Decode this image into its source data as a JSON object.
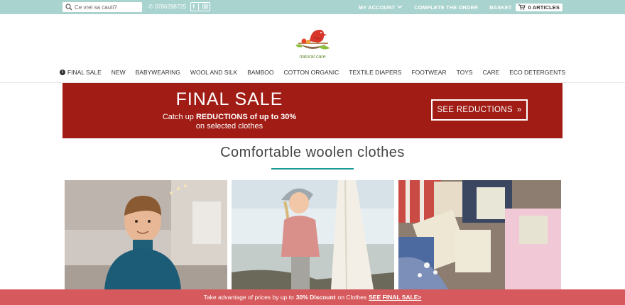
{
  "topbar": {
    "search_placeholder": "Ce vrei sa cauti?",
    "phone": "0786288725",
    "my_account": "MY ACCOUNT",
    "complete_order": "COMPLETE THE ORDER",
    "basket": "BASKET",
    "basket_count": "0 ARTICLES"
  },
  "logo": {
    "text": "natural care"
  },
  "nav": {
    "items": [
      "FINAL SALE",
      "NEW",
      "BABYWEARING",
      "WOOL AND SILK",
      "BAMBOO",
      "COTTON ORGANIC",
      "TEXTILE DIAPERS",
      "FOOTWEAR",
      "TOYS",
      "CARE",
      "ECO DETERGENTS"
    ]
  },
  "banner": {
    "title": "FINAL SALE",
    "sub_prefix": "Catch up ",
    "sub_bold": "REDUCTIONS of up to 30%",
    "sub_line2": "on selected clothes",
    "button": "SEE REDUCTIONS",
    "button_arrow": "»"
  },
  "section": {
    "title": "Comfortable woolen clothes"
  },
  "bottom": {
    "prefix": "Take advantage of prices by up to",
    "bold": "30% Discount",
    "middle": "on Clothes",
    "link": "SEE FINAL SALE>"
  },
  "colors": {
    "topbar": "#a9d3cf",
    "banner": "#a01c15",
    "accent": "#1a9b94",
    "bottom": "#d65a5d"
  },
  "icons": [
    "search-icon",
    "phone-icon",
    "facebook-icon",
    "instagram-icon",
    "chevron-down-icon",
    "cart-icon",
    "info-icon",
    "bird-logo-icon"
  ]
}
